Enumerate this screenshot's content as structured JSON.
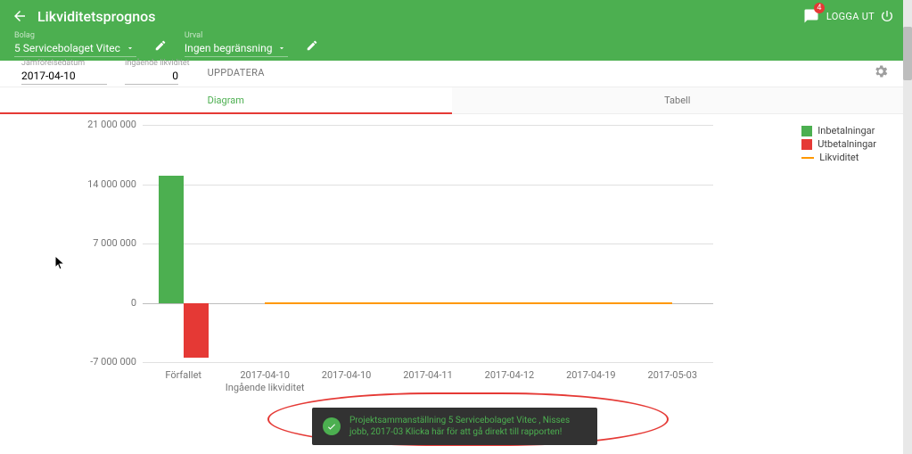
{
  "header": {
    "title": "Likviditetsprognos",
    "badge": "4",
    "logout": "LOGGA UT"
  },
  "selectors": {
    "bolag_label": "Bolag",
    "bolag_value": "5 Servicebolaget Vitec",
    "urval_label": "Urval",
    "urval_value": "Ingen begränsning"
  },
  "filters": {
    "jamfor_label": "Jämförelsedatum",
    "jamfor_value": "2017-04-10",
    "ingaende_label": "Ingående likviditet",
    "ingaende_value": "0",
    "uppdatera": "UPPDATERA"
  },
  "tabs": {
    "diagram": "Diagram",
    "tabell": "Tabell"
  },
  "legend": {
    "in": "Inbetalningar",
    "ut": "Utbetalningar",
    "liq": "Likviditet"
  },
  "toast": {
    "text": "Projektsammanställning 5 Servicebolaget Vitec , Nisses jobb, 2017-03 Klicka här för att gå direkt till rapporten!"
  },
  "chart_data": {
    "type": "bar",
    "title": "",
    "ylabel": "",
    "ylim": [
      -7000000,
      21000000
    ],
    "yticks": [
      -7000000,
      0,
      7000000,
      14000000,
      21000000
    ],
    "ytick_labels": [
      "-7 000 000",
      "0",
      "7 000 000",
      "14 000 000",
      "21 000 000"
    ],
    "categories": [
      "Förfallet",
      "2017-04-10",
      "2017-04-10",
      "2017-04-11",
      "2017-04-12",
      "2017-04-19",
      "2017-05-03"
    ],
    "category_sub": [
      "",
      "Ingående likviditet",
      "",
      "",
      "",
      "",
      ""
    ],
    "series": [
      {
        "name": "Inbetalningar",
        "color": "#4caf50",
        "values": [
          15000000,
          0,
          0,
          0,
          0,
          0,
          0
        ]
      },
      {
        "name": "Utbetalningar",
        "color": "#e53935",
        "values": [
          -6500000,
          0,
          0,
          0,
          0,
          0,
          0
        ]
      },
      {
        "name": "Likviditet",
        "color": "#ff9800",
        "type": "line",
        "values": [
          null,
          0,
          100000,
          100000,
          100000,
          100000,
          100000
        ]
      }
    ]
  }
}
